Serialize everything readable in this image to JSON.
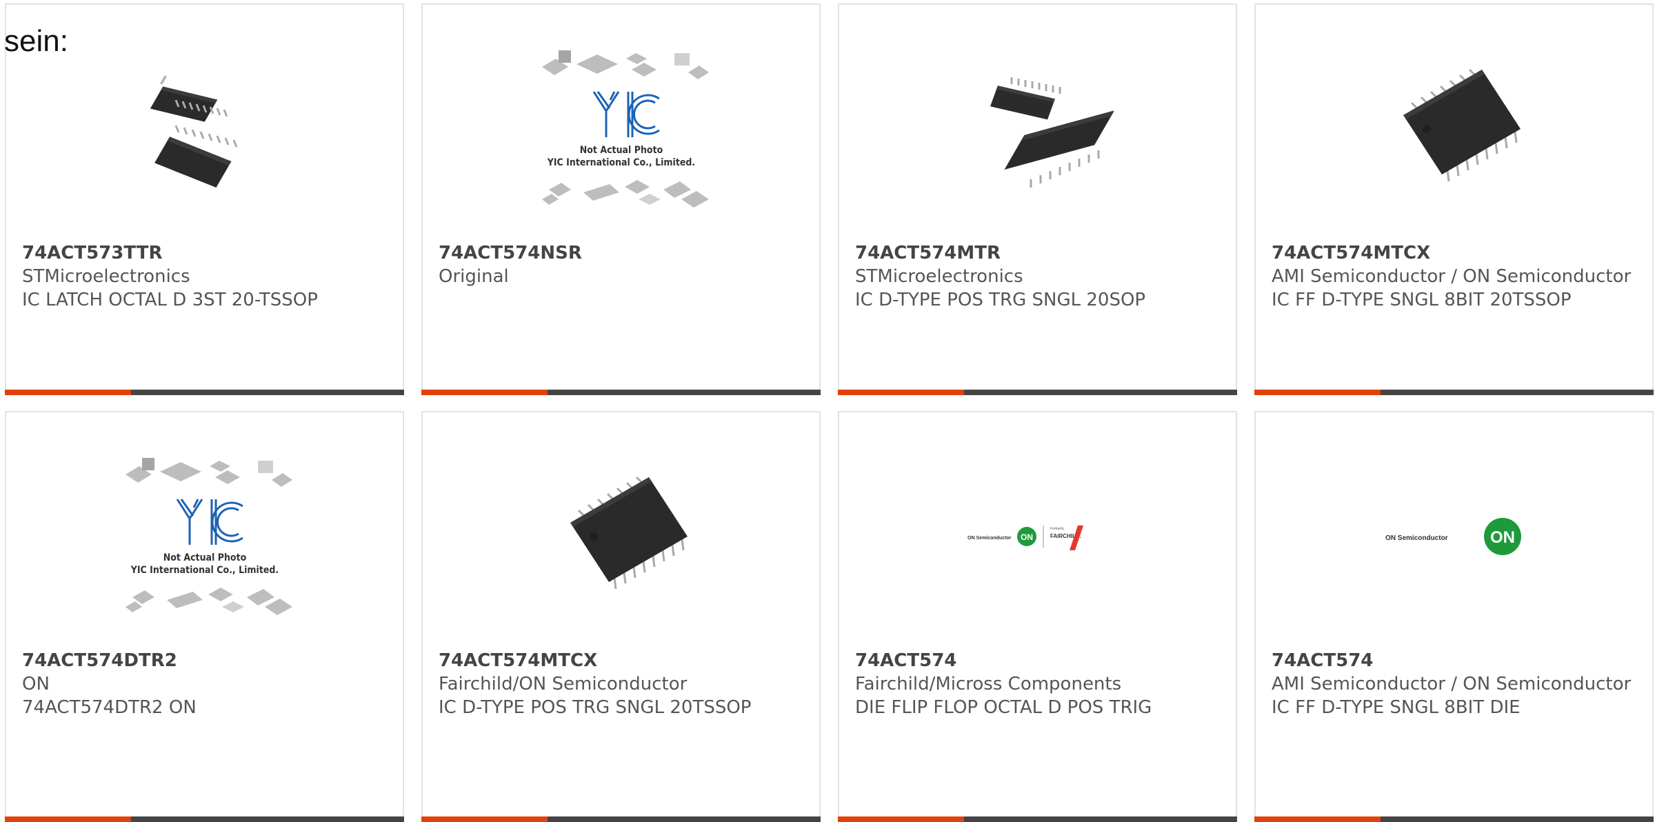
{
  "intro_text": "sein:",
  "yic_logo": {
    "letters": "YIC",
    "note_line1": "Not Actual Photo",
    "note_line2": "YIC International Co., Limited."
  },
  "products": [
    {
      "part": "74ACT573TTR",
      "manufacturer": "STMicroelectronics",
      "description": "IC LATCH OCTAL D 3ST 20-TSSOP",
      "image": "tssop-chip-pair"
    },
    {
      "part": "74ACT574NSR",
      "manufacturer": "Original",
      "description": "",
      "image": "yic-placeholder"
    },
    {
      "part": "74ACT574MTR",
      "manufacturer": "STMicroelectronics",
      "description": "IC D-TYPE POS TRG SNGL 20SOP",
      "image": "sop-chip-pair"
    },
    {
      "part": "74ACT574MTCX",
      "manufacturer": "AMI Semiconductor / ON Semiconductor",
      "description": "IC FF D-TYPE SNGL 8BIT 20TSSOP",
      "image": "tssop-chip-single"
    },
    {
      "part": "74ACT574DTR2",
      "manufacturer": "ON",
      "description": "74ACT574DTR2 ON",
      "image": "yic-placeholder"
    },
    {
      "part": "74ACT574MTCX",
      "manufacturer": "Fairchild/ON Semiconductor",
      "description": "IC D-TYPE POS TRG SNGL 20TSSOP",
      "image": "tssop-chip-single"
    },
    {
      "part": "74ACT574",
      "manufacturer": "Fairchild/Micross Components",
      "description": "DIE FLIP FLOP OCTAL D POS TRIG",
      "image": "on-fairchild-logo"
    },
    {
      "part": "74ACT574",
      "manufacturer": "AMI Semiconductor / ON Semiconductor",
      "description": "IC FF D-TYPE SNGL 8BIT DIE",
      "image": "on-semiconductor-logo"
    }
  ],
  "logos": {
    "on_semiconductor": "ON Semiconductor",
    "on_short": "ON",
    "fairchild_formerly": "Formerly",
    "fairchild": "FAIRCHILD."
  },
  "colors": {
    "accent": "#e2410c",
    "bar": "#444444",
    "text": "#555555",
    "border": "#e2e2e2",
    "on_green": "#1e9a3a"
  }
}
